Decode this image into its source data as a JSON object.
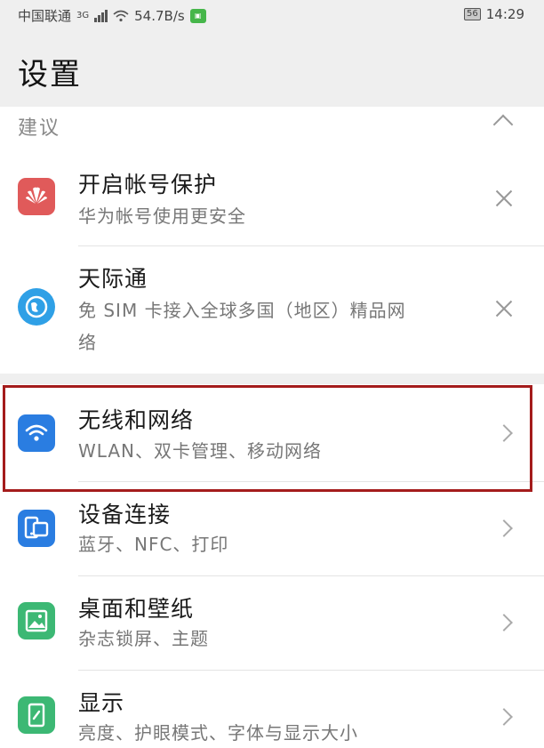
{
  "status": {
    "carrier": "中国联通",
    "network": "3G",
    "speed": "54.7B/s",
    "battery": "56",
    "time": "14:29"
  },
  "header": {
    "title": "设置"
  },
  "suggestions": {
    "label": "建议",
    "items": [
      {
        "title": "开启帐号保护",
        "subtitle": "华为帐号使用更安全",
        "icon": "huawei-logo-icon",
        "color": "#e05a5a"
      },
      {
        "title": "天际通",
        "subtitle": "免 SIM 卡接入全球多国（地区）精品网络",
        "subtitle_line1": "免 SIM 卡接入全球多国（地区）精品网",
        "subtitle_line2": "络",
        "icon": "globe-icon",
        "color": "#2fa0e6"
      }
    ]
  },
  "settings": {
    "items": [
      {
        "title": "无线和网络",
        "subtitle": "WLAN、双卡管理、移动网络",
        "icon": "wifi-icon",
        "color": "#2a7de1"
      },
      {
        "title": "设备连接",
        "subtitle": "蓝牙、NFC、打印",
        "icon": "device-connection-icon",
        "color": "#2a7de1"
      },
      {
        "title": "桌面和壁纸",
        "subtitle": "杂志锁屏、主题",
        "icon": "wallpaper-icon",
        "color": "#3cb874"
      },
      {
        "title": "显示",
        "subtitle": "亮度、护眼模式、字体与显示大小",
        "icon": "display-icon",
        "color": "#3cb874"
      }
    ]
  },
  "colors": {
    "highlight": "#a41c1c",
    "background": "#efefef"
  }
}
